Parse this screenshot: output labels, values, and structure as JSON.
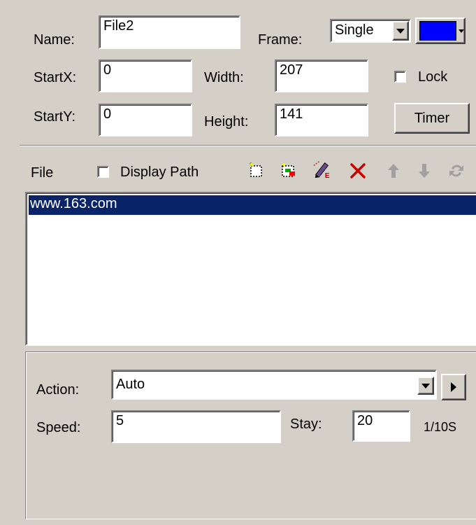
{
  "properties": {
    "name_label": "Name:",
    "name_value": "File2",
    "frame_label": "Frame:",
    "frame_value": "Single",
    "frame_color": "#0000ff",
    "startx_label": "StartX:",
    "startx_value": "0",
    "width_label": "Width:",
    "width_value": "207",
    "lock_label": "Lock",
    "lock_checked": false,
    "starty_label": "StartY:",
    "starty_value": "0",
    "height_label": "Height:",
    "height_value": "141",
    "timer_label": "Timer"
  },
  "file_section": {
    "label": "File",
    "display_path_label": "Display Path",
    "display_path_checked": false,
    "toolbar_icons": [
      "new-file-icon",
      "add-file-icon",
      "edit-icon",
      "delete-icon",
      "move-up-icon",
      "move-down-icon",
      "refresh-icon"
    ],
    "items": [
      "www.163.com"
    ],
    "selected_index": 0
  },
  "action_panel": {
    "action_label": "Action:",
    "action_value": "Auto",
    "speed_label": "Speed:",
    "speed_value": "5",
    "stay_label": "Stay:",
    "stay_value": "20",
    "stay_unit": "1/10S"
  },
  "colors": {
    "background": "#d4d0c8",
    "selection": "#0a246a",
    "delete_red": "#cc0000"
  }
}
